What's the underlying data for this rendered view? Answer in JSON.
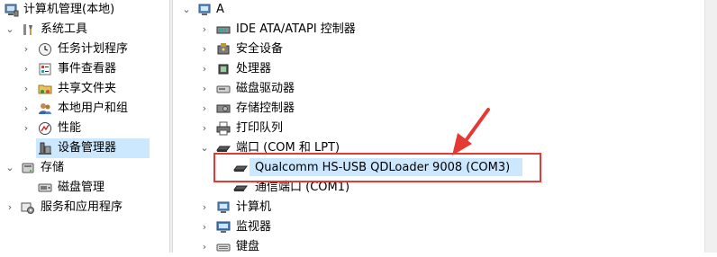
{
  "left_tree": [
    {
      "label": "计算机管理(本地)",
      "icon": "computer-management-icon",
      "expander": ""
    },
    {
      "label": "系统工具",
      "icon": "tools-icon",
      "expander": "expanded"
    },
    {
      "label": "任务计划程序",
      "icon": "clock-icon",
      "expander": "collapsed"
    },
    {
      "label": "事件查看器",
      "icon": "event-viewer-icon",
      "expander": "collapsed"
    },
    {
      "label": "共享文件夹",
      "icon": "shared-folder-icon",
      "expander": "collapsed"
    },
    {
      "label": "本地用户和组",
      "icon": "users-icon",
      "expander": "collapsed"
    },
    {
      "label": "性能",
      "icon": "performance-icon",
      "expander": "collapsed"
    },
    {
      "label": "设备管理器",
      "icon": "device-manager-icon",
      "expander": ""
    },
    {
      "label": "存储",
      "icon": "storage-icon",
      "expander": "expanded"
    },
    {
      "label": "磁盘管理",
      "icon": "disk-management-icon",
      "expander": ""
    },
    {
      "label": "服务和应用程序",
      "icon": "services-icon",
      "expander": "collapsed"
    }
  ],
  "right_tree": {
    "root": {
      "label": "A",
      "icon": "computer-icon",
      "expander": "expanded"
    },
    "categories": [
      {
        "label": "IDE ATA/ATAPI 控制器",
        "icon": "ide-controller-icon",
        "expander": "collapsed"
      },
      {
        "label": "安全设备",
        "icon": "security-device-icon",
        "expander": "collapsed"
      },
      {
        "label": "处理器",
        "icon": "processor-icon",
        "expander": "collapsed"
      },
      {
        "label": "磁盘驱动器",
        "icon": "disk-drive-icon",
        "expander": "collapsed"
      },
      {
        "label": "存储控制器",
        "icon": "storage-controller-icon",
        "expander": "collapsed"
      },
      {
        "label": "打印队列",
        "icon": "printer-icon",
        "expander": "collapsed"
      },
      {
        "label": "端口 (COM 和 LPT)",
        "icon": "port-icon",
        "expander": "expanded"
      },
      {
        "label": "Qualcomm HS-USB QDLoader 9008 (COM3)",
        "icon": "port-device-icon",
        "expander": ""
      },
      {
        "label": "通信端口 (COM1)",
        "icon": "port-device-icon",
        "expander": ""
      },
      {
        "label": "计算机",
        "icon": "computer-icon",
        "expander": "collapsed"
      },
      {
        "label": "监视器",
        "icon": "monitor-icon",
        "expander": "collapsed"
      },
      {
        "label": "键盘",
        "icon": "keyboard-icon",
        "expander": "collapsed"
      }
    ]
  },
  "colors": {
    "selection": "#cce8ff",
    "annotation": "#e53935"
  }
}
